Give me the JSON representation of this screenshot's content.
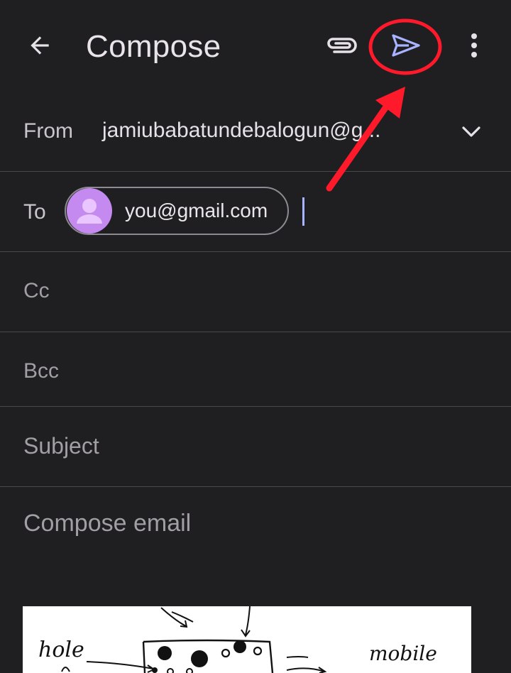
{
  "appbar": {
    "title": "Compose",
    "icons": {
      "back": "arrow-back-icon",
      "attach": "paperclip-icon",
      "send": "send-icon",
      "more": "more-vert-icon"
    }
  },
  "from": {
    "label": "From",
    "value": "jamiubabatundebalogun@g..."
  },
  "to": {
    "label": "To",
    "chip_email": "you@gmail.com"
  },
  "cc": {
    "placeholder": "Cc"
  },
  "bcc": {
    "placeholder": "Bcc"
  },
  "subject": {
    "placeholder": "Subject"
  },
  "body": {
    "placeholder": "Compose email"
  },
  "sketch": {
    "labels": [
      "hole",
      "mobile"
    ]
  },
  "colors": {
    "background": "#1f1e21",
    "accent": "#a8b4ff",
    "annotation": "#ff1a2b",
    "avatar": "#c58af0"
  }
}
